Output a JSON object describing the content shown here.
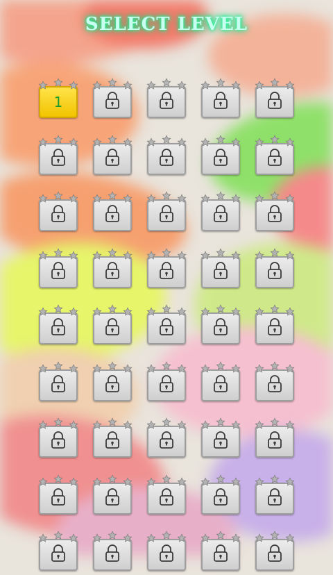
{
  "header": {
    "title": "SELECT LEVEL"
  },
  "colors": {
    "title_glow": "#1cff9e",
    "unlocked_fill": "#f2c400",
    "level_number": "#1a9a2e",
    "locked_fill": "#d6d6d6",
    "star": "#b3b3b3"
  },
  "levels": [
    {
      "label": "1",
      "locked": false,
      "stars": 0
    },
    {
      "label": "",
      "locked": true,
      "stars": 0
    },
    {
      "label": "",
      "locked": true,
      "stars": 0
    },
    {
      "label": "",
      "locked": true,
      "stars": 0
    },
    {
      "label": "",
      "locked": true,
      "stars": 0
    },
    {
      "label": "",
      "locked": true,
      "stars": 0
    },
    {
      "label": "",
      "locked": true,
      "stars": 0
    },
    {
      "label": "",
      "locked": true,
      "stars": 0
    },
    {
      "label": "",
      "locked": true,
      "stars": 0
    },
    {
      "label": "",
      "locked": true,
      "stars": 0
    },
    {
      "label": "",
      "locked": true,
      "stars": 0
    },
    {
      "label": "",
      "locked": true,
      "stars": 0
    },
    {
      "label": "",
      "locked": true,
      "stars": 0
    },
    {
      "label": "",
      "locked": true,
      "stars": 0
    },
    {
      "label": "",
      "locked": true,
      "stars": 0
    },
    {
      "label": "",
      "locked": true,
      "stars": 0
    },
    {
      "label": "",
      "locked": true,
      "stars": 0
    },
    {
      "label": "",
      "locked": true,
      "stars": 0
    },
    {
      "label": "",
      "locked": true,
      "stars": 0
    },
    {
      "label": "",
      "locked": true,
      "stars": 0
    },
    {
      "label": "",
      "locked": true,
      "stars": 0
    },
    {
      "label": "",
      "locked": true,
      "stars": 0
    },
    {
      "label": "",
      "locked": true,
      "stars": 0
    },
    {
      "label": "",
      "locked": true,
      "stars": 0
    },
    {
      "label": "",
      "locked": true,
      "stars": 0
    },
    {
      "label": "",
      "locked": true,
      "stars": 0
    },
    {
      "label": "",
      "locked": true,
      "stars": 0
    },
    {
      "label": "",
      "locked": true,
      "stars": 0
    },
    {
      "label": "",
      "locked": true,
      "stars": 0
    },
    {
      "label": "",
      "locked": true,
      "stars": 0
    },
    {
      "label": "",
      "locked": true,
      "stars": 0
    },
    {
      "label": "",
      "locked": true,
      "stars": 0
    },
    {
      "label": "",
      "locked": true,
      "stars": 0
    },
    {
      "label": "",
      "locked": true,
      "stars": 0
    },
    {
      "label": "",
      "locked": true,
      "stars": 0
    },
    {
      "label": "",
      "locked": true,
      "stars": 0
    },
    {
      "label": "",
      "locked": true,
      "stars": 0
    },
    {
      "label": "",
      "locked": true,
      "stars": 0
    },
    {
      "label": "",
      "locked": true,
      "stars": 0
    },
    {
      "label": "",
      "locked": true,
      "stars": 0
    },
    {
      "label": "",
      "locked": true,
      "stars": 0
    },
    {
      "label": "",
      "locked": true,
      "stars": 0
    },
    {
      "label": "",
      "locked": true,
      "stars": 0
    },
    {
      "label": "",
      "locked": true,
      "stars": 0
    },
    {
      "label": "",
      "locked": true,
      "stars": 0
    }
  ]
}
